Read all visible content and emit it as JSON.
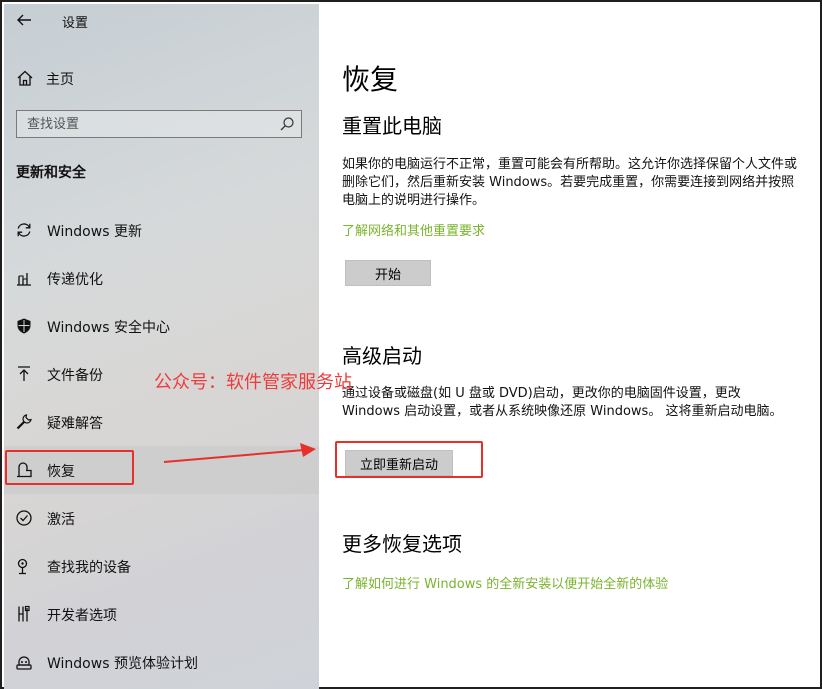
{
  "window": {
    "title": "设置"
  },
  "sidebar": {
    "home_label": "主页",
    "search_placeholder": "查找设置",
    "section_title": "更新和安全",
    "items": [
      {
        "label": "Windows 更新",
        "icon": "sync-icon"
      },
      {
        "label": "传递优化",
        "icon": "delivery-optimization-icon"
      },
      {
        "label": "Windows 安全中心",
        "icon": "shield-icon"
      },
      {
        "label": "文件备份",
        "icon": "backup-arrow-icon"
      },
      {
        "label": "疑难解答",
        "icon": "wrench-icon"
      },
      {
        "label": "恢复",
        "icon": "recovery-icon",
        "selected": true
      },
      {
        "label": "激活",
        "icon": "check-circle-icon"
      },
      {
        "label": "查找我的设备",
        "icon": "find-device-icon"
      },
      {
        "label": "开发者选项",
        "icon": "developer-icon"
      },
      {
        "label": "Windows 预览体验计划",
        "icon": "insider-icon"
      }
    ]
  },
  "main": {
    "title": "恢复",
    "reset": {
      "heading": "重置此电脑",
      "description": "如果你的电脑运行不正常，重置可能会有所帮助。这允许你选择保留个人文件或删除它们，然后重新安装 Windows。若要完成重置，你需要连接到网络并按照电脑上的说明进行操作。",
      "link": "了解网络和其他重置要求",
      "button": "开始"
    },
    "advanced": {
      "heading": "高级启动",
      "description": "通过设备或磁盘(如 U 盘或 DVD)启动，更改你的电脑固件设置，更改 Windows 启动设置，或者从系统映像还原 Windows。 这将重新启动电脑。",
      "button": "立即重新启动"
    },
    "more": {
      "heading": "更多恢复选项",
      "link": "了解如何进行 Windows 的全新安装以便开始全新的体验"
    }
  },
  "annotation": {
    "watermark": "公众号：软件管家服务站"
  },
  "colors": {
    "link": "#7ab32e",
    "highlight": "#e7302a",
    "sidebar_bg": "#d4d6d8",
    "button_bg": "#cccccc"
  }
}
